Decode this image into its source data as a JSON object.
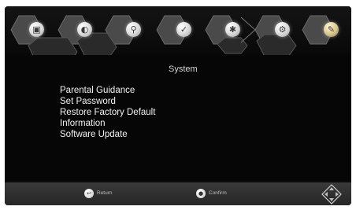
{
  "menu_bar": {
    "icons": [
      {
        "name": "media-icon",
        "glyph": "▣"
      },
      {
        "name": "image-icon",
        "glyph": "◐"
      },
      {
        "name": "search-icon",
        "glyph": "⚲"
      },
      {
        "name": "time-icon",
        "glyph": "✓"
      },
      {
        "name": "network-icon",
        "glyph": "✱"
      },
      {
        "name": "settings-icon",
        "glyph": "⚙"
      },
      {
        "name": "system-icon",
        "glyph": "✎",
        "active": true
      }
    ]
  },
  "panel": {
    "title": "System",
    "items": [
      "Parental Guidance",
      "Set Password",
      "Restore Factory Default",
      "Information",
      "Software Update"
    ]
  },
  "footer": {
    "return_label": "Return",
    "confirm_label": "Confirm"
  },
  "colors": {
    "background": "#060606",
    "text": "#f2f2f2",
    "accent": "#c8b070"
  }
}
